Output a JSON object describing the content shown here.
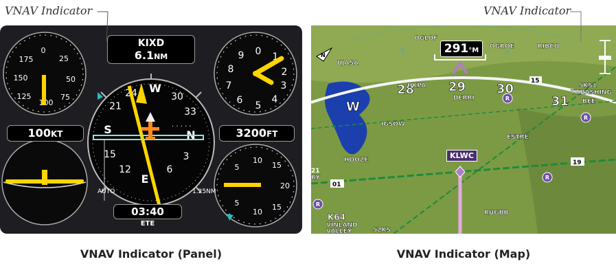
{
  "callouts": {
    "panel": "VNAV Indicator",
    "map": "VNAV Indicator"
  },
  "captions": {
    "panel": "VNAV Indicator (Panel)",
    "map": "VNAV Indicator (Map)"
  },
  "panel": {
    "waypoint": "KIXD",
    "distance": "6.1",
    "distance_unit": "NM",
    "airspeed": "100",
    "airspeed_unit": "KT",
    "altitude": "3200",
    "altitude_unit": "FT",
    "ete": "03:40",
    "ete_label": "ETE",
    "auto_label": "AUTO",
    "range_label": "1.25NM",
    "asi_ticks": [
      "0",
      "25",
      "50",
      "75",
      "100",
      "125",
      "150",
      "175"
    ],
    "alt_ticks": [
      "0",
      "1",
      "2",
      "3",
      "4",
      "5",
      "6",
      "7",
      "8",
      "9"
    ],
    "vsi_ticks": [
      "5",
      "10",
      "15",
      "20",
      "15",
      "10",
      "5"
    ],
    "hsi_labels": [
      "N",
      "33",
      "30",
      "W",
      "24",
      "21",
      "S",
      "15",
      "12",
      "E",
      "6",
      "3"
    ],
    "colors": {
      "needle": "#ffd400",
      "ownship": "#ff8a1c",
      "cdi": "#8fe0e0",
      "bug": "#20c0c0"
    }
  },
  "map": {
    "track": "291",
    "track_unit": "M",
    "destination": "KLWC",
    "north_label": "N",
    "heading_labels": [
      "W",
      "28",
      "29",
      "30",
      "31"
    ],
    "heading_small_labels": [
      "8",
      "9"
    ],
    "waypoints": [
      "OGLOF",
      "OGROE",
      "RIBCO",
      "UJASA",
      "HKPA",
      "DERRI",
      "IGSOW",
      "ESTRE",
      "HOOZE",
      "RUGBB",
      "5KS1",
      "THRASHING",
      "BEE",
      "VINLAND",
      "VALLEY",
      "52KS",
      "RY"
    ],
    "airport_id": "K64",
    "airway_labels": [
      "19",
      "01",
      "15",
      "21"
    ],
    "map_r_label": "R",
    "colors": {
      "terrain": "#7c9a44",
      "water": "#1c3fae",
      "airway": "#1e8a3c",
      "flight_plan": "#e6a8e6"
    }
  }
}
